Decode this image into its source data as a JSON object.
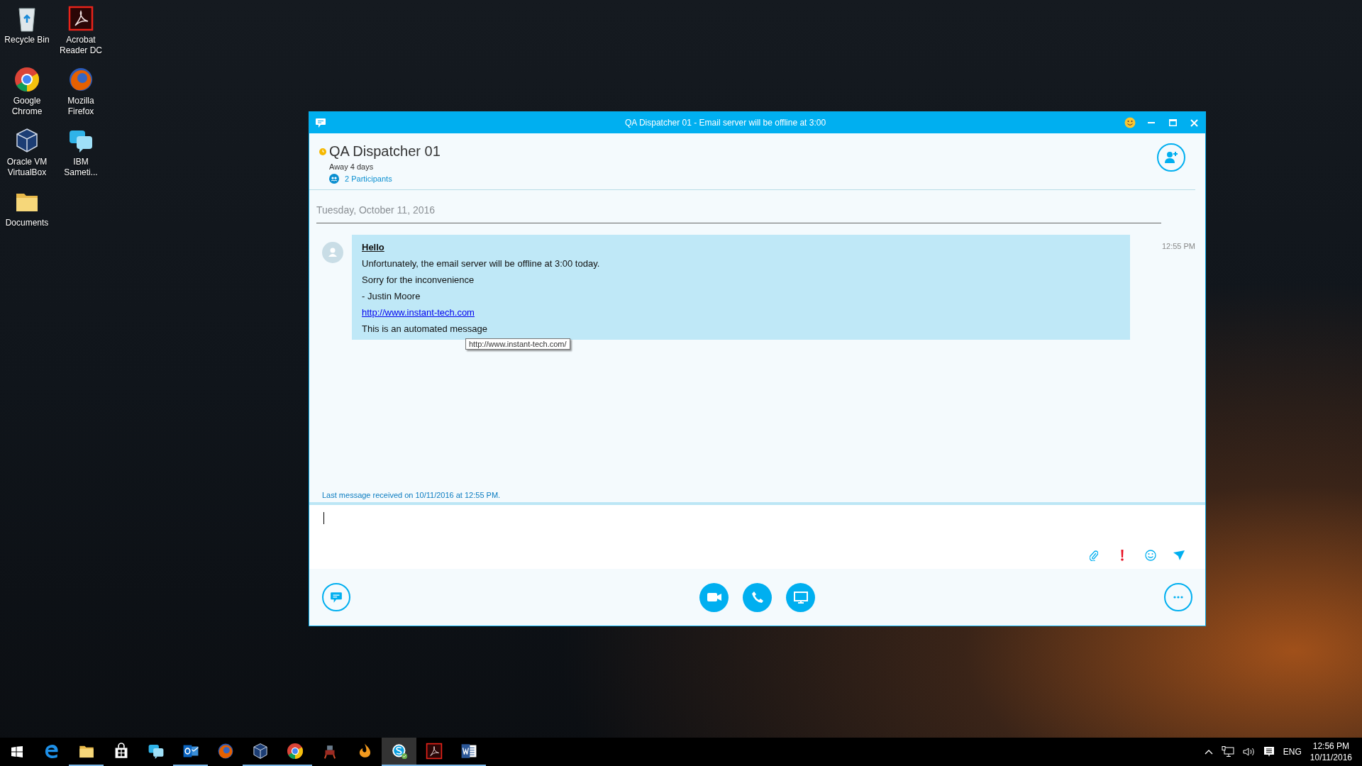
{
  "desktop_icons": [
    {
      "kind": "recycle",
      "label": "Recycle Bin"
    },
    {
      "kind": "pdf",
      "label": "Acrobat Reader DC"
    },
    {
      "kind": "chrome",
      "label": "Google Chrome"
    },
    {
      "kind": "firefox",
      "label": "Mozilla Firefox"
    },
    {
      "kind": "cube",
      "label": "Oracle VM VirtualBox"
    },
    {
      "kind": "chat",
      "label": "IBM Sameti..."
    },
    {
      "kind": "folder",
      "label": "Documents"
    }
  ],
  "window": {
    "title": "QA Dispatcher 01 - Email server will be offline at 3:00",
    "contact": {
      "name": "QA Dispatcher 01",
      "status": "Away 4 days",
      "participants": "2 Participants"
    },
    "date": "Tuesday, October 11, 2016",
    "message": {
      "heading": "Hello",
      "time": "12:55 PM",
      "lines": [
        {
          "kind": "text",
          "text": "Unfortunately, the email server will be offline at 3:00 today."
        },
        {
          "kind": "text",
          "text": "Sorry for the inconvenience"
        },
        {
          "kind": "text",
          "text": "- Justin Moore"
        },
        {
          "kind": "link",
          "text": "http://www.instant-tech.com"
        },
        {
          "kind": "text",
          "text": "This is an automated message"
        }
      ]
    },
    "tooltip": "http://www.instant-tech.com/",
    "last_message": "Last message received on 10/11/2016 at 12:55 PM."
  },
  "taskbar": {
    "items": [
      {
        "kind": "edge",
        "running": false,
        "selected": false
      },
      {
        "kind": "folder",
        "running": true,
        "selected": false
      },
      {
        "kind": "store",
        "running": false,
        "selected": false
      },
      {
        "kind": "chat",
        "running": false,
        "selected": false
      },
      {
        "kind": "mail",
        "running": true,
        "selected": false
      },
      {
        "kind": "firefox",
        "running": false,
        "selected": false
      },
      {
        "kind": "cube",
        "running": true,
        "selected": false
      },
      {
        "kind": "chrome",
        "running": true,
        "selected": false
      },
      {
        "kind": "robot",
        "running": false,
        "selected": false
      },
      {
        "kind": "flame",
        "running": false,
        "selected": false
      },
      {
        "kind": "skype",
        "running": true,
        "selected": true
      },
      {
        "kind": "pdf",
        "running": true,
        "selected": false
      },
      {
        "kind": "word",
        "running": true,
        "selected": false
      }
    ],
    "language": "ENG",
    "time": "12:56 PM",
    "date": "10/11/2016"
  }
}
